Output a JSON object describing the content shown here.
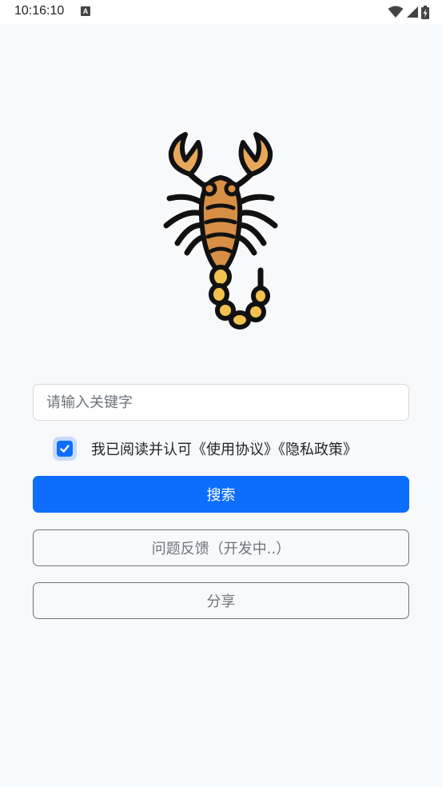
{
  "status_bar": {
    "time": "10:16:10",
    "notification_icon": "font-a-icon",
    "icons": [
      "wifi-icon",
      "cellular-signal-icon",
      "battery-charging-icon"
    ]
  },
  "logo": {
    "icon": "scorpion-icon",
    "colors": {
      "outline": "#111111",
      "body": "#d78f45",
      "tail": "#f2c14e",
      "claw_tip": "#e8a85a"
    }
  },
  "search": {
    "placeholder": "请输入关键字",
    "value": ""
  },
  "agreement": {
    "checked": true,
    "text": "我已阅读并认可《使用协议》《隐私政策》"
  },
  "buttons": {
    "search_label": "搜索",
    "feedback_label": "问题反馈（开发中..）",
    "share_label": "分享"
  },
  "colors": {
    "primary": "#0d6efd",
    "secondary": "#6c757d",
    "background": "#f8f9fb"
  }
}
